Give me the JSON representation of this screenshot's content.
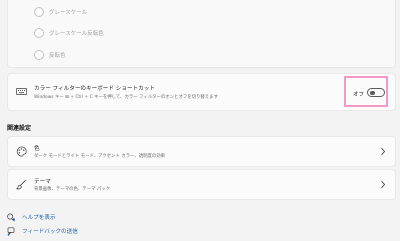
{
  "filter_options": [
    {
      "label": "グレースケール"
    },
    {
      "label": "グレースケール反転色"
    },
    {
      "label": "反転色"
    }
  ],
  "keyboard_shortcut": {
    "title": "カラー フィルターのキーボード ショートカット",
    "description": "Windows キー ⊞ + Ctrl + C キーを押して、カラー フィルターのオンとオフを切り替えます",
    "toggle_label": "オフ",
    "toggle_on": false
  },
  "related_settings": {
    "heading": "関連設定",
    "items": [
      {
        "title": "色",
        "description": "ダーク モードとライト モード、アクセント カラー、透明度の効果",
        "icon": "palette-icon"
      },
      {
        "title": "テーマ",
        "description": "背景画像、テーマの色、テーマ パック",
        "icon": "brush-icon"
      }
    ]
  },
  "footer_links": [
    {
      "label": "ヘルプを表示",
      "icon": "help-icon"
    },
    {
      "label": "フィードバックの送信",
      "icon": "feedback-icon"
    }
  ],
  "colors": {
    "accent_highlight": "#f29ac4",
    "link": "#1d5fa8",
    "background": "#f3f3f3",
    "card": "#fbfbfb"
  }
}
